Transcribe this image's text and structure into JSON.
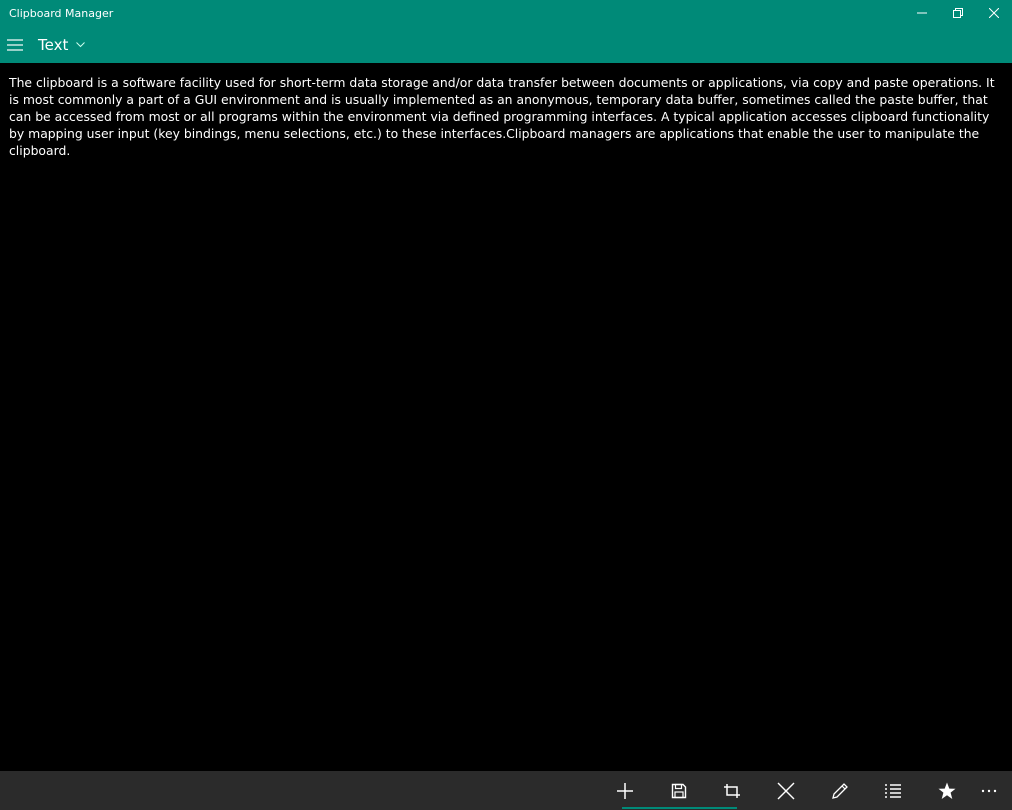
{
  "window": {
    "title": "Clipboard Manager",
    "controls": [
      "minimize-icon",
      "restore-icon",
      "close-icon"
    ]
  },
  "header": {
    "menu_icon": "hamburger-icon",
    "title": "Text",
    "dropdown_icon": "chevron-down-icon"
  },
  "content": {
    "text": "The clipboard is a software facility used for short-term data storage and/or data transfer between documents or applications, via copy and paste operations. It is most commonly a part of a GUI environment and is usually implemented as an anonymous, temporary data buffer, sometimes called the paste buffer, that can be accessed from most or all programs within the environment via defined programming interfaces. A typical application accesses clipboard functionality by mapping user input (key bindings, menu selections, etc.) to these interfaces.Clipboard managers are applications that enable the user to manipulate the clipboard."
  },
  "commandbar": {
    "buttons": [
      "add-icon",
      "save-icon",
      "crop-icon",
      "delete-icon",
      "edit-icon",
      "list-icon",
      "favorite-icon",
      "more-icon"
    ]
  },
  "colors": {
    "accent": "#008a78",
    "background": "#000000",
    "commandbar": "#2b2b2b",
    "text": "#ffffff"
  }
}
